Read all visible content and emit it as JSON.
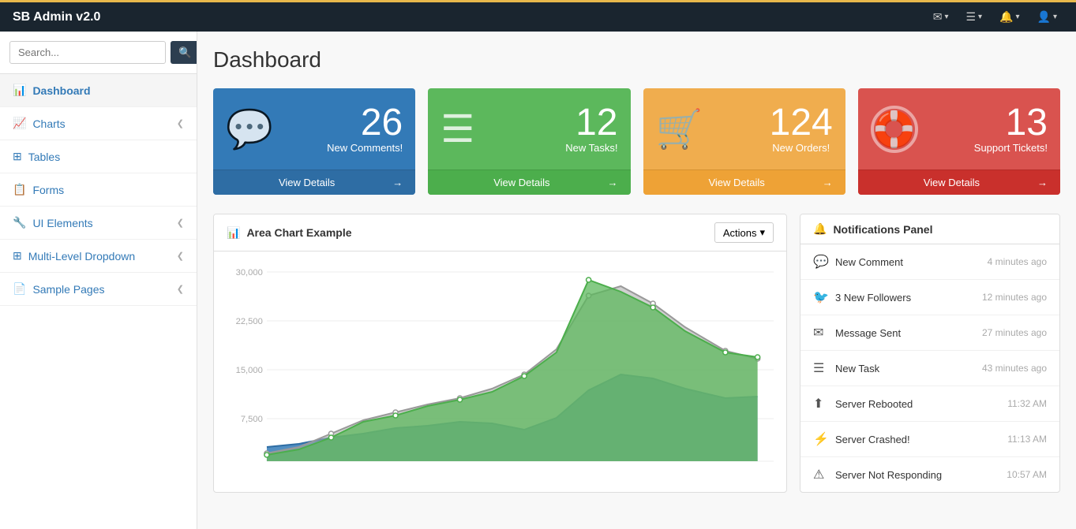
{
  "app": {
    "brand": "SB Admin v2.0"
  },
  "topnav": {
    "icons": [
      {
        "name": "mail-icon",
        "symbol": "✉",
        "label": "Mail"
      },
      {
        "name": "list-icon",
        "symbol": "☰",
        "label": "Tasks"
      },
      {
        "name": "bell-icon",
        "symbol": "🔔",
        "label": "Alerts"
      },
      {
        "name": "user-icon",
        "symbol": "👤",
        "label": "User"
      }
    ]
  },
  "sidebar": {
    "search_placeholder": "Search...",
    "search_button_label": "🔍",
    "items": [
      {
        "id": "dashboard",
        "label": "Dashboard",
        "icon": "📊",
        "active": true,
        "arrow": false
      },
      {
        "id": "charts",
        "label": "Charts",
        "icon": "📈",
        "active": false,
        "arrow": true
      },
      {
        "id": "tables",
        "label": "Tables",
        "icon": "⊞",
        "active": false,
        "arrow": false
      },
      {
        "id": "forms",
        "label": "Forms",
        "icon": "📋",
        "active": false,
        "arrow": false
      },
      {
        "id": "ui-elements",
        "label": "UI Elements",
        "icon": "🔧",
        "active": false,
        "arrow": true
      },
      {
        "id": "multi-level",
        "label": "Multi-Level Dropdown",
        "icon": "⊞",
        "active": false,
        "arrow": true
      },
      {
        "id": "sample-pages",
        "label": "Sample Pages",
        "icon": "📄",
        "active": false,
        "arrow": true
      }
    ]
  },
  "main": {
    "page_title": "Dashboard",
    "stat_cards": [
      {
        "id": "comments",
        "color_class": "card-blue",
        "icon": "💬",
        "number": "26",
        "label": "New Comments!",
        "footer_text": "View Details",
        "footer_arrow": "→"
      },
      {
        "id": "tasks",
        "color_class": "card-green",
        "icon": "☰",
        "number": "12",
        "label": "New Tasks!",
        "footer_text": "View Details",
        "footer_arrow": "→"
      },
      {
        "id": "orders",
        "color_class": "card-orange",
        "icon": "🛒",
        "number": "124",
        "label": "New Orders!",
        "footer_text": "View Details",
        "footer_arrow": "→"
      },
      {
        "id": "tickets",
        "color_class": "card-red",
        "icon": "🔴",
        "number": "13",
        "label": "Support Tickets!",
        "footer_text": "View Details",
        "footer_arrow": "→"
      }
    ],
    "chart": {
      "title": "Area Chart Example",
      "actions_label": "Actions",
      "y_labels": [
        "30,000",
        "22,500",
        "15,000",
        "7,500",
        ""
      ],
      "data_blue": [
        3000,
        4000,
        5500,
        7000,
        8500,
        9000,
        10000,
        9500,
        8000,
        9000,
        12000,
        15000,
        14000,
        11000,
        10000
      ],
      "data_gray": [
        2000,
        3000,
        5000,
        8000,
        9500,
        11000,
        12000,
        14000,
        16000,
        20000,
        25000,
        28000,
        22000,
        18000,
        16000
      ],
      "data_green": [
        1500,
        2500,
        4000,
        7000,
        8000,
        10000,
        11000,
        13000,
        15000,
        19000,
        27000,
        23000,
        18000,
        15000,
        14000
      ]
    },
    "notifications": {
      "title": "Notifications Panel",
      "items": [
        {
          "icon": "💬",
          "text": "New Comment",
          "time": "4 minutes ago"
        },
        {
          "icon": "🐦",
          "text": "3 New Followers",
          "time": "12 minutes ago"
        },
        {
          "icon": "✉",
          "text": "Message Sent",
          "time": "27 minutes ago"
        },
        {
          "icon": "☰",
          "text": "New Task",
          "time": "43 minutes ago"
        },
        {
          "icon": "⬆",
          "text": "Server Rebooted",
          "time": "11:32 AM"
        },
        {
          "icon": "⚡",
          "text": "Server Crashed!",
          "time": "11:13 AM"
        },
        {
          "icon": "⚠",
          "text": "Server Not Responding",
          "time": "10:57 AM"
        }
      ]
    }
  }
}
